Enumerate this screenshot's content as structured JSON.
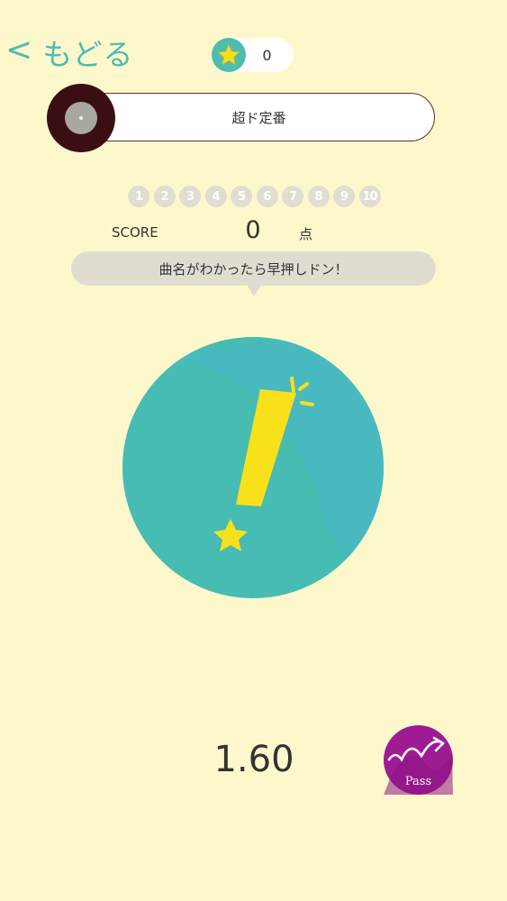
{
  "nav": {
    "back_arrow": "<",
    "back_label": "もどる"
  },
  "stars": {
    "count": "0",
    "icon": "star-icon"
  },
  "genre": {
    "title": "超ド定番"
  },
  "questions": [
    "1",
    "2",
    "3",
    "4",
    "5",
    "6",
    "7",
    "8",
    "9",
    "10"
  ],
  "score": {
    "label": "SCORE",
    "value": "0",
    "unit": "点"
  },
  "hint": {
    "text": "曲名がわかったら早押しドン！"
  },
  "timer": {
    "value": "1.60"
  },
  "pass": {
    "label": "Pass"
  },
  "colors": {
    "background": "#fdf8cc",
    "accent": "#4dbcb1",
    "buzzer": "#46bcb3",
    "exclamation": "#f8e01a",
    "pass": "#9e1b93",
    "record": "#3a0f12"
  }
}
